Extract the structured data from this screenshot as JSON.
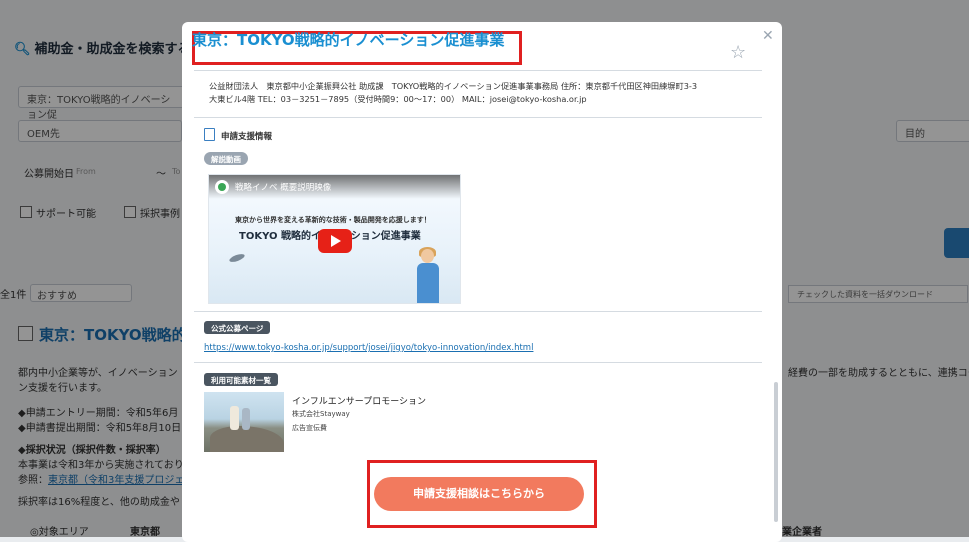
{
  "background": {
    "search_title": "補助金・助成金を検索する",
    "region_value": "東京：TOKYO戦略的イノベーション促",
    "oem_placeholder": "OEM先",
    "purpose_placeholder": "目的",
    "date_label": "公募開始日",
    "date_from": "From",
    "date_sep": "〜",
    "date_to": "To",
    "checkbox_support": "サポート可能",
    "checkbox_examples": "採択事例",
    "result_count": "全1件",
    "sort_value": "おすすめ",
    "download_label": "チェックした資料を一括ダウンロード",
    "card_title": "東京：TOKYO戦略的",
    "desc_line1": "都内中小企業等が、イノベーション",
    "desc_line1_right": "経費の一部を助成するとともに、連携コー",
    "desc_line2": "ン支援を行います。",
    "entry_period": "◆申請エントリー期間：令和5年6月",
    "submit_period": "◆申請書提出期間：令和5年8月10日",
    "adoption_status": "◆採択状況（採択件数・採択率）",
    "adoption_text": "本事業は令和3年から実施されており",
    "reference_label": "参照：",
    "reference_link": "東京都（令和3年支援プロジェ",
    "adoption_rate": "採択率は16%程度と、他の助成金や",
    "target_area_label": "対象エリア",
    "target_area_value": "東京都",
    "target_business": "業企業者"
  },
  "modal": {
    "title": "東京：TOKYO戦略的イノベーション促進事業",
    "info_line1": "公益財団法人　東京都中小企業振興公社 助成課　TOKYO戦略的イノベーション促進事業事務局 住所：東京都千代田区神田練塀町3-3",
    "info_line2": "大東ビル4階 TEL：03－3251－7895（受付時間9：00〜17：00） MAIL：josei@tokyo-kosha.or.jp",
    "section_title": "申請支援情報",
    "video_label": "解説動画",
    "video": {
      "title": "戦略イノベ 概要説明映像",
      "subtitle": "東京から世界を変える革新的な技術・製品開発を応援します！",
      "main": "TOKYO 戦略的イノベーション促進事業"
    },
    "official_label": "公式公募ページ",
    "official_url": "https://www.tokyo-kosha.or.jp/support/josei/jigyo/tokyo-innovation/index.html",
    "materials_label": "利用可能素材一覧",
    "material": {
      "name": "インフルエンサープロモーション",
      "company": "株式会社Stayway",
      "category": "広告宣伝費"
    },
    "cta_label": "申請支援相談はこちらから"
  },
  "colors": {
    "accent": "#1a8fd1",
    "highlight": "#e02020",
    "cta": "#f27a5e"
  }
}
